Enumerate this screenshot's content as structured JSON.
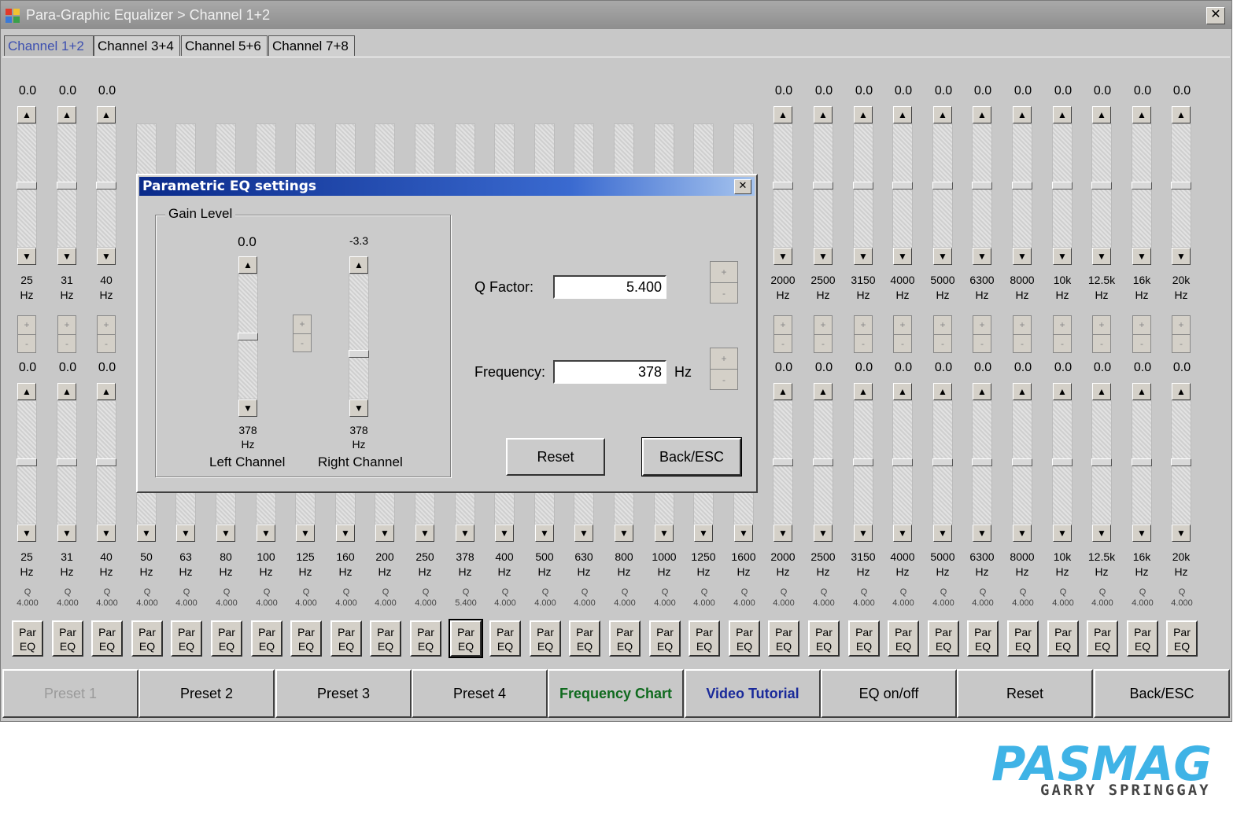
{
  "window": {
    "title": "Para-Graphic Equalizer > Channel 1+2",
    "close_label": "✕"
  },
  "tabs": [
    {
      "label": "Channel 1+2",
      "active": true
    },
    {
      "label": "Channel 3+4",
      "active": false
    },
    {
      "label": "Channel 5+6",
      "active": false
    },
    {
      "label": "Channel 7+8",
      "active": false
    }
  ],
  "bands": [
    {
      "freq": "25",
      "q": "4.000"
    },
    {
      "freq": "31",
      "q": "4.000"
    },
    {
      "freq": "40",
      "q": "4.000"
    },
    {
      "freq": "50",
      "q": "4.000"
    },
    {
      "freq": "63",
      "q": "4.000"
    },
    {
      "freq": "80",
      "q": "4.000"
    },
    {
      "freq": "100",
      "q": "4.000"
    },
    {
      "freq": "125",
      "q": "4.000"
    },
    {
      "freq": "160",
      "q": "4.000"
    },
    {
      "freq": "200",
      "q": "4.000"
    },
    {
      "freq": "250",
      "q": "4.000"
    },
    {
      "freq": "378",
      "q": "5.400"
    },
    {
      "freq": "400",
      "q": "4.000"
    },
    {
      "freq": "500",
      "q": "4.000"
    },
    {
      "freq": "630",
      "q": "4.000"
    },
    {
      "freq": "800",
      "q": "4.000"
    },
    {
      "freq": "1000",
      "q": "4.000"
    },
    {
      "freq": "1250",
      "q": "4.000"
    },
    {
      "freq": "1600",
      "q": "4.000"
    },
    {
      "freq": "2000",
      "q": "4.000"
    },
    {
      "freq": "2500",
      "q": "4.000"
    },
    {
      "freq": "3150",
      "q": "4.000"
    },
    {
      "freq": "4000",
      "q": "4.000"
    },
    {
      "freq": "5000",
      "q": "4.000"
    },
    {
      "freq": "6300",
      "q": "4.000"
    },
    {
      "freq": "8000",
      "q": "4.000"
    },
    {
      "freq": "10k",
      "q": "4.000"
    },
    {
      "freq": "12.5k",
      "q": "4.000"
    },
    {
      "freq": "16k",
      "q": "4.000"
    },
    {
      "freq": "20k",
      "q": "4.000"
    }
  ],
  "common": {
    "gain": "0.0",
    "hz": "Hz",
    "q_label": "Q",
    "par_label": "Par",
    "eq_label": "EQ",
    "plus": "+",
    "minus": "-",
    "up": "▲",
    "down": "▼"
  },
  "selected_band": "378",
  "bottom_buttons": [
    {
      "label": "Preset 1",
      "color": "#9a9a9a"
    },
    {
      "label": "Preset 2",
      "color": "#000000"
    },
    {
      "label": "Preset 3",
      "color": "#000000"
    },
    {
      "label": "Preset 4",
      "color": "#000000"
    },
    {
      "label": "Frequency Chart",
      "color": "#0f6a1e"
    },
    {
      "label": "Video Tutorial",
      "color": "#1a2a9a"
    },
    {
      "label": "EQ on/off",
      "color": "#000000"
    },
    {
      "label": "Reset",
      "color": "#000000"
    },
    {
      "label": "Back/ESC",
      "color": "#000000"
    }
  ],
  "dialog": {
    "title": "Parametric EQ settings",
    "close_label": "✕",
    "gain_group_label": "Gain Level",
    "left": {
      "value": "0.0",
      "freq": "378",
      "hz": "Hz",
      "label": "Left Channel",
      "level_db": 0.0
    },
    "right": {
      "value": "-3.3",
      "freq": "378",
      "hz": "Hz",
      "label": "Right Channel",
      "level_db": -3.3
    },
    "q_label": "Q Factor:",
    "q_value": "5.400",
    "freq_label": "Frequency:",
    "freq_value": "378",
    "freq_unit": "Hz",
    "reset_label": "Reset",
    "back_label": "Back/ESC"
  },
  "brand": {
    "logo_text": "PASMAG",
    "credit": "GARRY SPRINGGAY",
    "logo_color": "#3fb3e6",
    "credit_color": "#444444"
  }
}
